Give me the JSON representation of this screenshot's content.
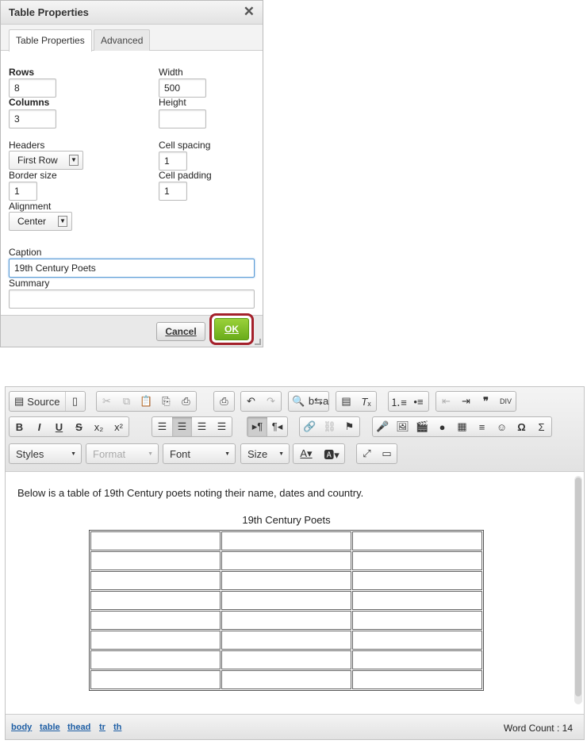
{
  "dialog": {
    "title": "Table Properties",
    "close_glyph": "✕",
    "tabs": [
      "Table Properties",
      "Advanced"
    ],
    "rows_label": "Rows",
    "rows_value": "8",
    "columns_label": "Columns",
    "columns_value": "3",
    "width_label": "Width",
    "width_value": "500",
    "height_label": "Height",
    "height_value": "",
    "headers_label": "Headers",
    "headers_value": "First Row",
    "cell_spacing_label": "Cell spacing",
    "cell_spacing_value": "1",
    "border_size_label": "Border size",
    "border_size_value": "1",
    "cell_padding_label": "Cell padding",
    "cell_padding_value": "1",
    "alignment_label": "Alignment",
    "alignment_value": "Center",
    "caption_label": "Caption",
    "caption_value": "19th Century Poets",
    "summary_label": "Summary",
    "summary_value": "",
    "cancel_label": "Cancel",
    "ok_label": "OK"
  },
  "editor": {
    "source_label": "Source",
    "styles_label": "Styles",
    "format_label": "Format",
    "font_label": "Font",
    "size_label": "Size",
    "body_text": "Below is a table of 19th Century poets noting their name, dates and country.",
    "table_caption": "19th Century Poets",
    "table_rows": 8,
    "table_cols": 3,
    "path": [
      "body",
      "table",
      "thead",
      "tr",
      "th"
    ],
    "word_count_label": "Word Count : 14"
  }
}
